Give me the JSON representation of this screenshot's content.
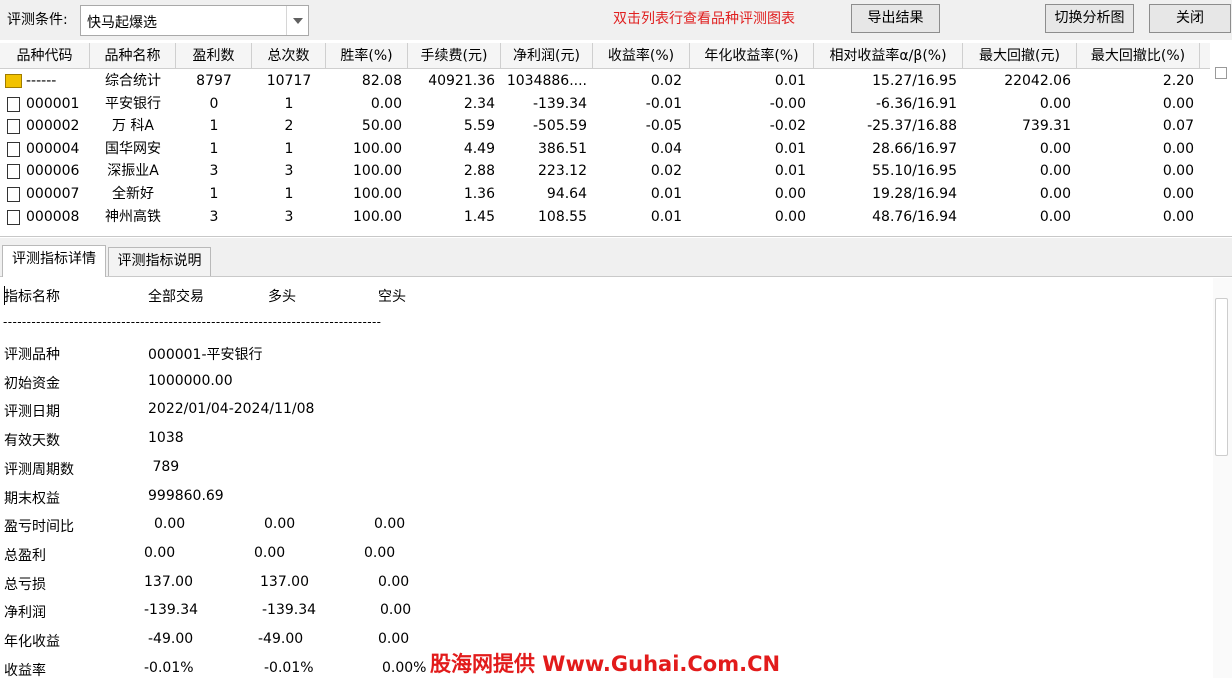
{
  "toolbar": {
    "condition_label": "评测条件:",
    "condition_value": "快马起爆选",
    "hint": "双击列表行查看品种评测图表",
    "export_label": "导出结果",
    "switch_label": "切换分析图",
    "close_label": "关闭"
  },
  "table": {
    "headers": [
      "品种代码",
      "品种名称",
      "盈利数",
      "总次数",
      "胜率(%)",
      "手续费(元)",
      "净利润(元)",
      "收益率(%)",
      "年化收益率(%)",
      "相对收益率α/β(%)",
      "最大回撤(元)",
      "最大回撤比(%)"
    ],
    "rows": [
      [
        "------",
        "综合统计",
        "8797",
        "10717",
        "82.08",
        "40921.36",
        "1034886....",
        "0.02",
        "0.01",
        "15.27/16.95",
        "22042.06",
        "2.20"
      ],
      [
        "000001",
        "平安银行",
        "0",
        "1",
        "0.00",
        "2.34",
        "-139.34",
        "-0.01",
        "-0.00",
        "-6.36/16.91",
        "0.00",
        "0.00"
      ],
      [
        "000002",
        "万 科A",
        "1",
        "2",
        "50.00",
        "5.59",
        "-505.59",
        "-0.05",
        "-0.02",
        "-25.37/16.88",
        "739.31",
        "0.07"
      ],
      [
        "000004",
        "国华网安",
        "1",
        "1",
        "100.00",
        "4.49",
        "386.51",
        "0.04",
        "0.01",
        "28.66/16.97",
        "0.00",
        "0.00"
      ],
      [
        "000006",
        "深振业A",
        "3",
        "3",
        "100.00",
        "2.88",
        "223.12",
        "0.02",
        "0.01",
        "55.10/16.95",
        "0.00",
        "0.00"
      ],
      [
        "000007",
        "全新好",
        "1",
        "1",
        "100.00",
        "1.36",
        "94.64",
        "0.01",
        "0.00",
        "19.28/16.94",
        "0.00",
        "0.00"
      ],
      [
        "000008",
        "神州高铁",
        "3",
        "3",
        "100.00",
        "1.45",
        "108.55",
        "0.01",
        "0.00",
        "48.76/16.94",
        "0.00",
        "0.00"
      ]
    ]
  },
  "tabs": [
    "评测指标详情",
    "评测指标说明"
  ],
  "detail": {
    "header": [
      "指标名称",
      "全部交易",
      "多头",
      "空头"
    ],
    "separator": "--------------------------------------------------------------------------------",
    "info": [
      [
        "评测品种",
        "000001-平安银行"
      ],
      [
        "初始资金",
        "1000000.00"
      ],
      [
        "评测日期",
        "2022/01/04-2024/11/08"
      ],
      [
        "有效天数",
        "1038"
      ],
      [
        "评测周期数",
        " 789"
      ],
      [
        "期末权益",
        "999860.69"
      ]
    ],
    "metrics": [
      [
        "盈亏时间比",
        "0.00",
        "0.00",
        "0.00"
      ],
      [
        "总盈利",
        "0.00",
        "0.00",
        "0.00"
      ],
      [
        "总亏损",
        "137.00",
        "137.00",
        "0.00"
      ],
      [
        "净利润",
        "-139.34",
        "-139.34",
        "0.00"
      ],
      [
        "年化收益",
        "-49.00",
        "-49.00",
        "0.00"
      ],
      [
        "收益率",
        "-0.01%",
        "-0.01%",
        "0.00%"
      ]
    ]
  },
  "watermark": "股海网提供 Www.Guhai.Com.CN",
  "colors": {
    "hint": "#e02020",
    "watermark": "#e21b1b",
    "summary_icon": "#f2c200"
  }
}
